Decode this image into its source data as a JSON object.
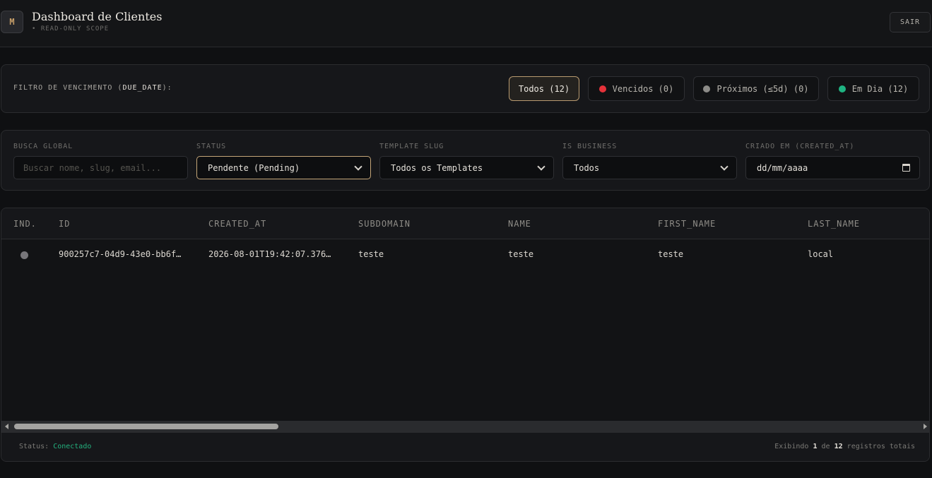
{
  "header": {
    "logo_letter": "M",
    "title": "Dashboard de Clientes",
    "subtitle": "• READ-ONLY SCOPE",
    "logout_label": "SAIR"
  },
  "due_filter": {
    "label_prefix": "FILTRO DE VENCIMENTO (",
    "label_key": "DUE_DATE",
    "label_suffix": "):",
    "buttons": [
      {
        "label": "Todos (12)",
        "active": true
      },
      {
        "label": "Vencidos (0)",
        "dot_color": "#e5323a"
      },
      {
        "label": "Próximos (≤5d) (0)",
        "dot_color": "#8c8b88"
      },
      {
        "label": "Em Dia (12)",
        "dot_color": "#1fb382"
      }
    ]
  },
  "filters": {
    "search": {
      "label": "BUSCA GLOBAL",
      "placeholder": "Buscar nome, slug, email..."
    },
    "status": {
      "label": "STATUS",
      "value": "Pendente (Pending)"
    },
    "template": {
      "label": "TEMPLATE SLUG",
      "value": "Todos os Templates"
    },
    "business": {
      "label": "IS BUSINESS",
      "value": "Todos"
    },
    "created": {
      "label": "CRIADO EM (CREATED_AT)",
      "value": "dd/mm/aaaa"
    }
  },
  "table": {
    "columns": [
      "IND.",
      "ID",
      "CREATED_AT",
      "SUBDOMAIN",
      "NAME",
      "FIRST_NAME",
      "LAST_NAME"
    ],
    "rows": [
      {
        "indicator_color": "#77767a",
        "id": "900257c7-04d9-43e0-bb6f…",
        "created_at": "2026-08-01T19:42:07.376…",
        "subdomain": "teste",
        "name": "teste",
        "first_name": "teste",
        "last_name": "local"
      }
    ]
  },
  "footer": {
    "status_label": "Status:",
    "status_value": "Conectado",
    "count_prefix": "Exibindo",
    "count_shown": "1",
    "count_mid": "de",
    "count_total": "12",
    "count_suffix": "registros totais"
  }
}
